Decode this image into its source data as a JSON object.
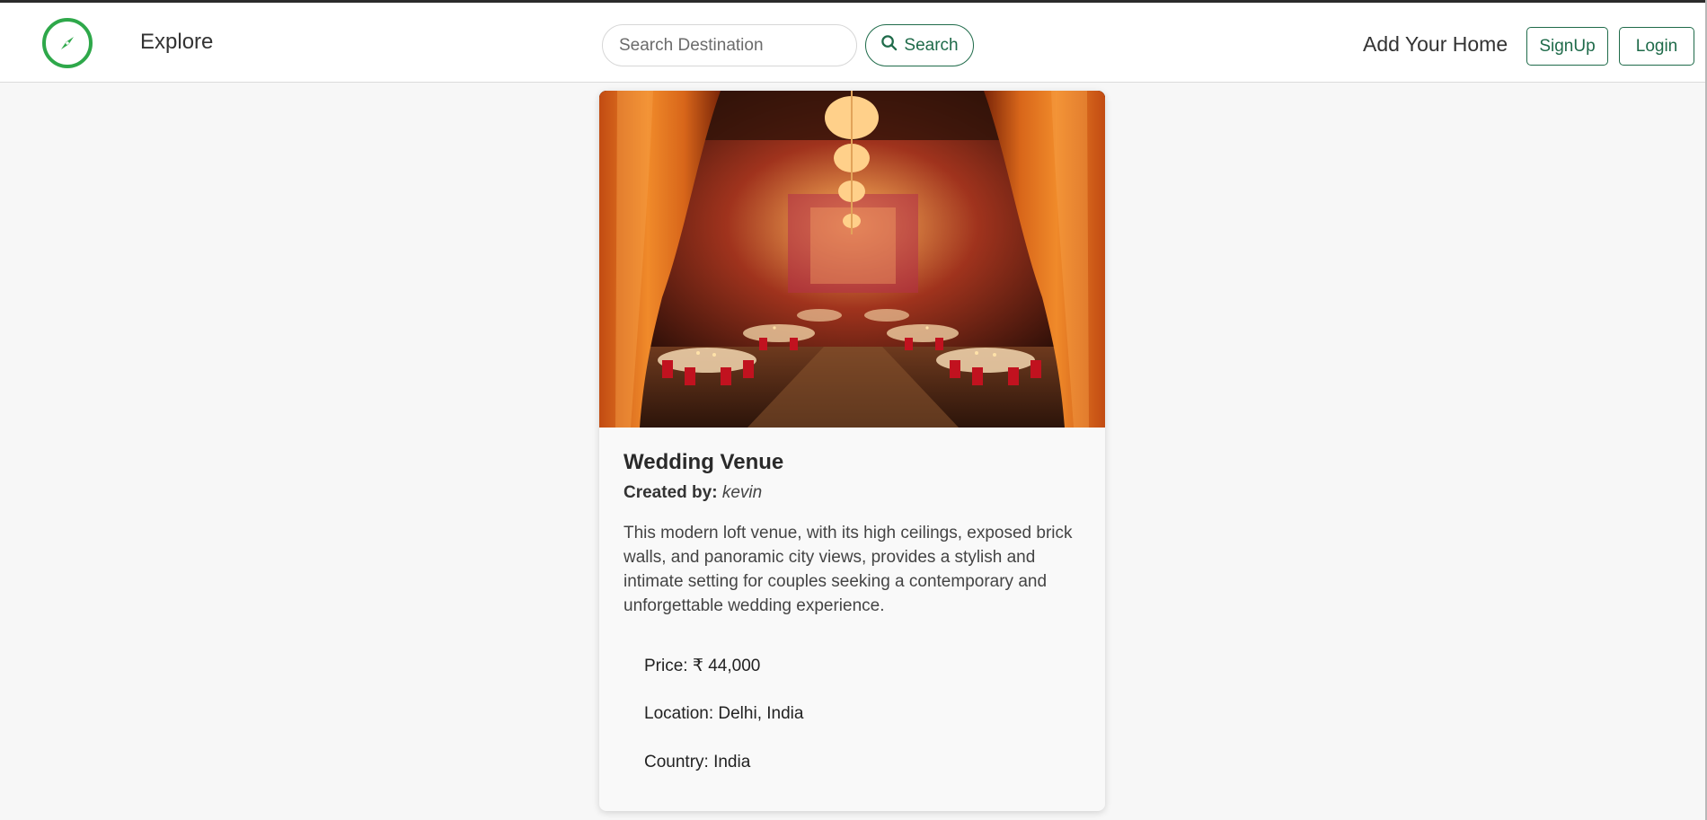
{
  "navbar": {
    "logo_icon": "compass-icon",
    "explore_label": "Explore",
    "search_placeholder": "Search Destination",
    "search_button_label": "Search",
    "search_icon": "search-icon",
    "add_home_label": "Add Your Home",
    "signup_label": "SignUp",
    "login_label": "Login",
    "accent_color": "#1f6b4a",
    "logo_color": "#2ea84a"
  },
  "listing": {
    "image_alt": "Wedding venue hall with orange drapes and chandeliers",
    "title": "Wedding Venue",
    "created_by_label": "Created by:",
    "created_by_user": "kevin",
    "description": "This modern loft venue, with its high ceilings, exposed brick walls, and panoramic city views, provides a stylish and intimate setting for couples seeking a contemporary and unforgettable wedding experience.",
    "price_text": "Price: ₹ 44,000",
    "location_text": "Location: Delhi, India",
    "country_text": "Country: India"
  }
}
